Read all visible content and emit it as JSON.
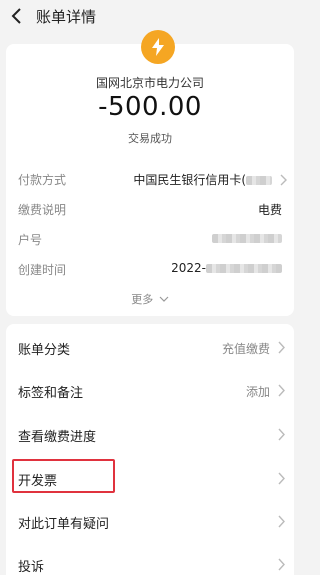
{
  "header": {
    "title": "账单详情"
  },
  "merchant": {
    "name": "国网北京市电力公司",
    "icon": "lightning-icon",
    "icon_color": "#f5a623"
  },
  "transaction": {
    "amount": "-500.00",
    "status": "交易成功"
  },
  "details": [
    {
      "label": "付款方式",
      "value": "中国民生银行信用卡("
    },
    {
      "label": "缴费说明",
      "value": "电费"
    },
    {
      "label": "户号",
      "value": ""
    },
    {
      "label": "创建时间",
      "value": "2022-"
    }
  ],
  "more_label": "更多",
  "list": [
    {
      "label": "账单分类",
      "value": "充值缴费"
    },
    {
      "label": "标签和备注",
      "value": "添加"
    },
    {
      "label": "查看缴费进度",
      "value": ""
    },
    {
      "label": "开发票",
      "value": ""
    },
    {
      "label": "对此订单有疑问",
      "value": ""
    },
    {
      "label": "投诉",
      "value": ""
    }
  ],
  "highlight_color": "#e0323e"
}
